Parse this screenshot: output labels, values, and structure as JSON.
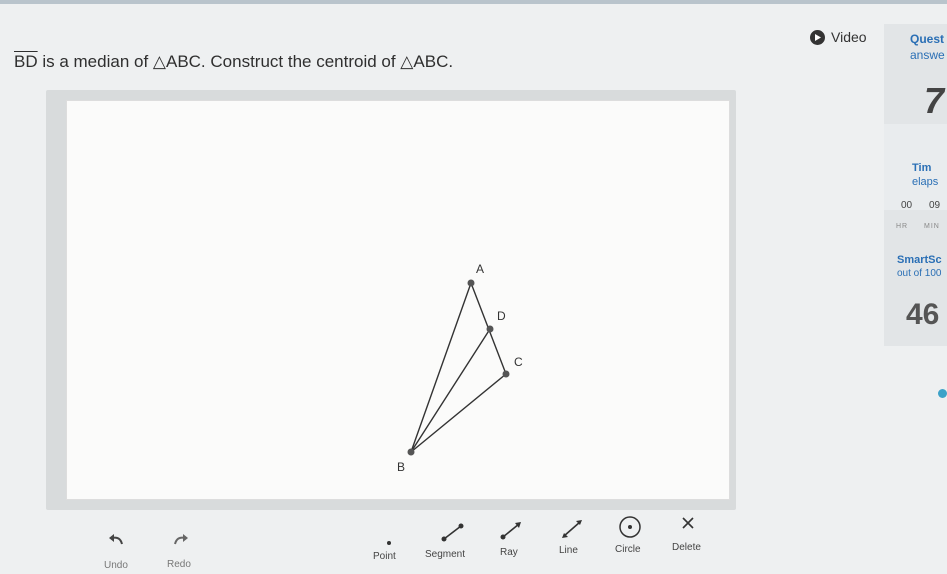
{
  "header": {
    "question_segment": "BD",
    "question_rest": " is a median of △ABC. Construct the centroid of △ABC.",
    "video_label": "Video"
  },
  "panel": {
    "questions_title": "Quest",
    "answered_title": "answe",
    "answered_count": "7",
    "time_title": "Tim",
    "time_sub": "elaps",
    "hours": "00",
    "minutes": "09",
    "hr_label": "HR",
    "min_label": "MIN",
    "smartscore_title": "SmartSc",
    "smartscore_sub": "out of 100",
    "smartscore_value": "46"
  },
  "figure": {
    "labels": {
      "A": "A",
      "B": "B",
      "C": "C",
      "D": "D"
    }
  },
  "toolbar": {
    "undo": "Undo",
    "redo": "Redo",
    "point": "Point",
    "segment": "Segment",
    "ray": "Ray",
    "line": "Line",
    "circle": "Circle",
    "delete": "Delete"
  }
}
